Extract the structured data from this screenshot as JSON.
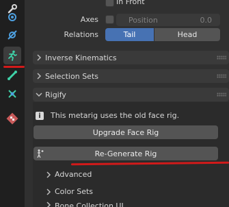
{
  "tabs": [
    {
      "name": "modifier-tab-icon",
      "color": "#e0e0e0"
    },
    {
      "name": "particles-tab-icon",
      "color": "#4ea0e0"
    },
    {
      "name": "physics-tab-icon",
      "color": "#4ea0e0"
    },
    {
      "name": "object-data-armature-icon",
      "color": "#3fd2a8"
    },
    {
      "name": "bone-tab-icon",
      "color": "#3fd2a8"
    },
    {
      "name": "bone-constraints-tab-icon",
      "color": "#3fd2a8"
    },
    {
      "name": "texture-tab-icon",
      "color": "#d05050"
    }
  ],
  "viewport_display": {
    "in_front_label": "In Front",
    "axes_label": "Axes",
    "position_label": "Position",
    "position_value": "0.0",
    "relations_label": "Relations",
    "relations_options": [
      "Tail",
      "Head"
    ],
    "relations_selected": "Tail"
  },
  "panels": {
    "inverse_kinematics": "Inverse Kinematics",
    "selection_sets": "Selection Sets",
    "rigify": "Rigify"
  },
  "rigify": {
    "info_message": "This metarig uses the old face rig.",
    "upgrade_button": "Upgrade Face Rig",
    "regenerate_button": "Re-Generate Rig",
    "subpanels": [
      "Advanced",
      "Color Sets",
      "Bone Collection UI"
    ]
  },
  "colors": {
    "accent": "#4772b3",
    "annotation_red": "#d21a1a"
  }
}
